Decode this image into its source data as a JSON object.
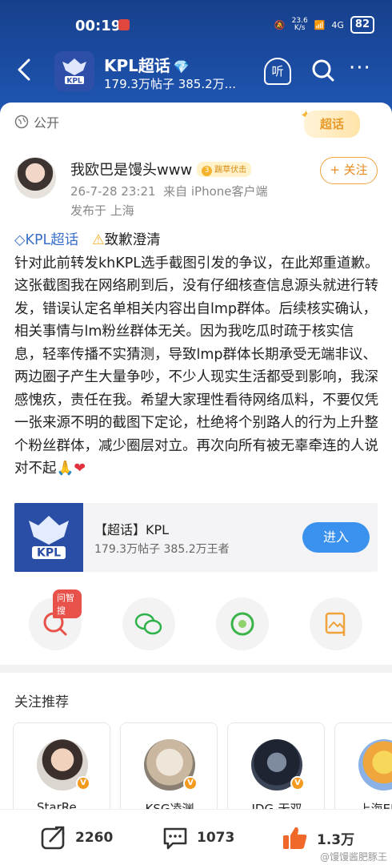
{
  "status": {
    "time": "00:19",
    "speed": "23.6",
    "speed_unit": "K/s",
    "net": "4G",
    "battery": "82"
  },
  "header": {
    "title": "KPL超话",
    "subtitle": "179.3万帖子 385.2万...",
    "listen_label": "听"
  },
  "visibility": {
    "label": "公开"
  },
  "badge": {
    "chaohua": "超话"
  },
  "post": {
    "username": "我欧巴是馒头www",
    "level_num": "3",
    "level_text": "踹草伏击",
    "follow_label": "+ 关注",
    "timestamp": "26-7-28 23:21",
    "source": "来自 iPhone客户端",
    "location": "发布于 上海",
    "topic_link": "KPL超话",
    "headline": "致歉澄清",
    "body": "针对此前转发khKPL选手截图引发的争议，在此郑重道歉。这张截图我在网络刷到后，没有仔细核查信息源头就进行转发，错误认定名单相关内容出自lmp群体。后续核实确认，相关事情与lm粉丝群体无关。因为我吃瓜时疏于核实信息，轻率传播不实猜测，导致lmp群体长期承受无端非议、两边圈子产生大量争吵，不少人现实生活都受到影响，我深感愧疚，责任在我。希望大家理性看待网络瓜料，不要仅凭一张来源不明的截图下定论，杜绝将个别路人的行为上升整个粉丝群体，减少圈层对立。再次向所有被无辜牵连的人说对不起"
  },
  "topic_card": {
    "title": "【超话】KPL",
    "subtitle": "179.3万帖子 385.2万王者",
    "enter_label": "进入"
  },
  "share": {
    "tag": "问智搜"
  },
  "recommend": {
    "title": "关注推荐",
    "items": [
      {
        "name": "StarRe..."
      },
      {
        "name": "KSG凌渊"
      },
      {
        "name": "JDG-无双"
      },
      {
        "name": "上海EDG"
      }
    ]
  },
  "actions": {
    "repost": "2260",
    "comment": "1073",
    "like": "1.3万"
  },
  "watermark": "@馒馒酱肥豚王",
  "colors": {
    "brand_blue": "#1f4e9e",
    "accent_orange": "#ea8a1c",
    "enter_blue": "#3a91ee"
  }
}
